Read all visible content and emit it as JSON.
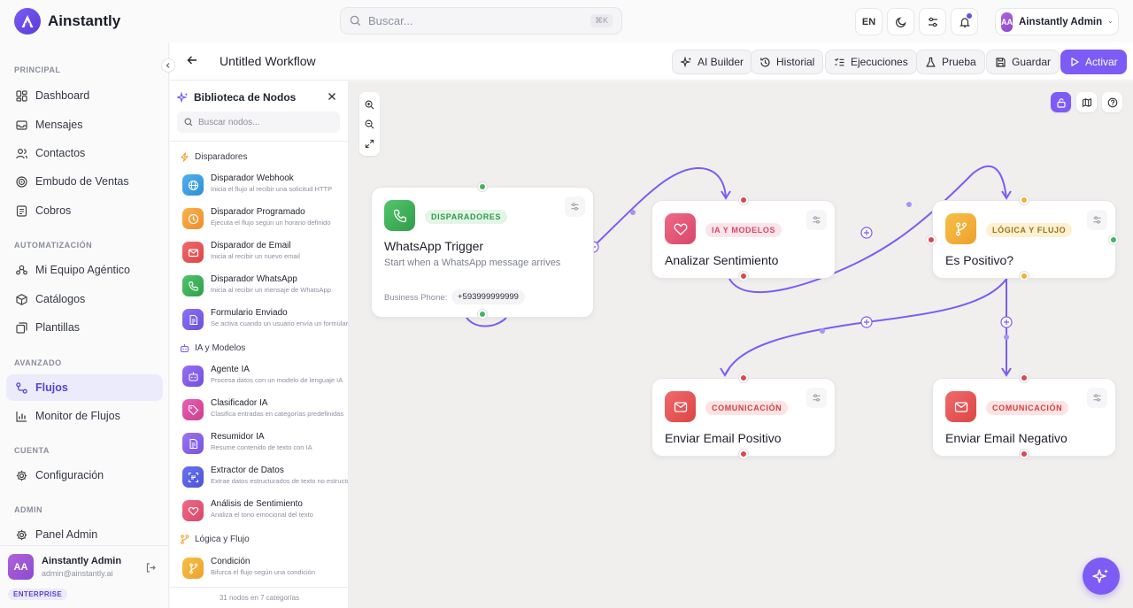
{
  "app": {
    "name": "Ainstantly"
  },
  "header": {
    "search_placeholder": "Buscar...",
    "search_shortcut": "⌘K",
    "language": "EN",
    "user_initials": "AA",
    "user_name": "Ainstantly Admin"
  },
  "sidebar": {
    "sections": [
      {
        "title": "PRINCIPAL",
        "items": [
          {
            "label": "Dashboard",
            "icon": "dashboard-icon"
          },
          {
            "label": "Mensajes",
            "icon": "inbox-icon"
          },
          {
            "label": "Contactos",
            "icon": "users-icon"
          },
          {
            "label": "Embudo de Ventas",
            "icon": "target-icon"
          },
          {
            "label": "Cobros",
            "icon": "receipt-icon"
          }
        ]
      },
      {
        "title": "AUTOMATIZACIÓN",
        "items": [
          {
            "label": "Mi Equipo Agéntico",
            "icon": "team-icon"
          },
          {
            "label": "Catálogos",
            "icon": "box-icon"
          },
          {
            "label": "Plantillas",
            "icon": "layers-icon"
          }
        ]
      },
      {
        "title": "AVANZADO",
        "items": [
          {
            "label": "Flujos",
            "icon": "workflow-icon",
            "active": true
          },
          {
            "label": "Monitor de Flujos",
            "icon": "chart-icon"
          }
        ]
      },
      {
        "title": "CUENTA",
        "items": [
          {
            "label": "Configuración",
            "icon": "gear-icon"
          }
        ]
      },
      {
        "title": "ADMIN",
        "items": [
          {
            "label": "Panel Admin",
            "icon": "gear-icon"
          }
        ]
      }
    ],
    "user": {
      "initials": "AA",
      "name": "Ainstantly Admin",
      "email": "admin@ainstantly.ai",
      "plan": "ENTERPRISE"
    }
  },
  "workflow": {
    "title": "Untitled Workflow",
    "buttons": {
      "ai_builder": "AI Builder",
      "history": "Historial",
      "executions": "Ejecuciones",
      "test": "Prueba",
      "save": "Guardar",
      "activate": "Activar"
    }
  },
  "library": {
    "title": "Biblioteca de Nodos",
    "search_placeholder": "Buscar nodos...",
    "categories": {
      "triggers": "Disparadores",
      "ai": "IA y Modelos",
      "logic": "Lógica y Flujo"
    },
    "items": {
      "webhook": {
        "title": "Disparador Webhook",
        "desc": "Inicia el flujo al recibir una solicitud HTTP"
      },
      "scheduled": {
        "title": "Disparador Programado",
        "desc": "Ejecuta el flujo según un horario definido"
      },
      "email": {
        "title": "Disparador de Email",
        "desc": "Inicia al recibir un nuevo email"
      },
      "whatsapp": {
        "title": "Disparador WhatsApp",
        "desc": "Inicia al recibir un mensaje de WhatsApp"
      },
      "form": {
        "title": "Formulario Enviado",
        "desc": "Se activa cuando un usuario envía un formulario"
      },
      "agent": {
        "title": "Agente IA",
        "desc": "Procesa datos con un modelo de lenguaje IA"
      },
      "classifier": {
        "title": "Clasificador IA",
        "desc": "Clasifica entradas en categorías predefinidas"
      },
      "summarizer": {
        "title": "Resumidor IA",
        "desc": "Resume contenido de texto con IA"
      },
      "extractor": {
        "title": "Extractor de Datos",
        "desc": "Extrae datos estructurados de texto no estructurado"
      },
      "sentiment": {
        "title": "Análisis de Sentimiento",
        "desc": "Analiza el tono emocional del texto"
      },
      "condition": {
        "title": "Condición",
        "desc": "Bifurca el flujo según una condición"
      }
    },
    "footer": "31 nodos en 7 categorías"
  },
  "nodes": {
    "trigger": {
      "chip": "DISPARADORES",
      "title": "WhatsApp Trigger",
      "desc": "Start when a WhatsApp message arrives",
      "field_label": "Business Phone:",
      "field_value": "+593999999999"
    },
    "sentiment": {
      "chip": "IA Y MODELOS",
      "title": "Analizar Sentimiento"
    },
    "condition": {
      "chip": "LÓGICA Y FLUJO",
      "title": "Es Positivo?"
    },
    "email_pos": {
      "chip": "COMUNICACIÓN",
      "title": "Enviar Email Positivo"
    },
    "email_neg": {
      "chip": "COMUNICACIÓN",
      "title": "Enviar Email Negativo"
    }
  },
  "colors": {
    "accent": "#7c5cf5",
    "trigger": "#3fb65c",
    "ai": "#e54d6b",
    "logic": "#f3b131",
    "communication": "#e6504f"
  }
}
